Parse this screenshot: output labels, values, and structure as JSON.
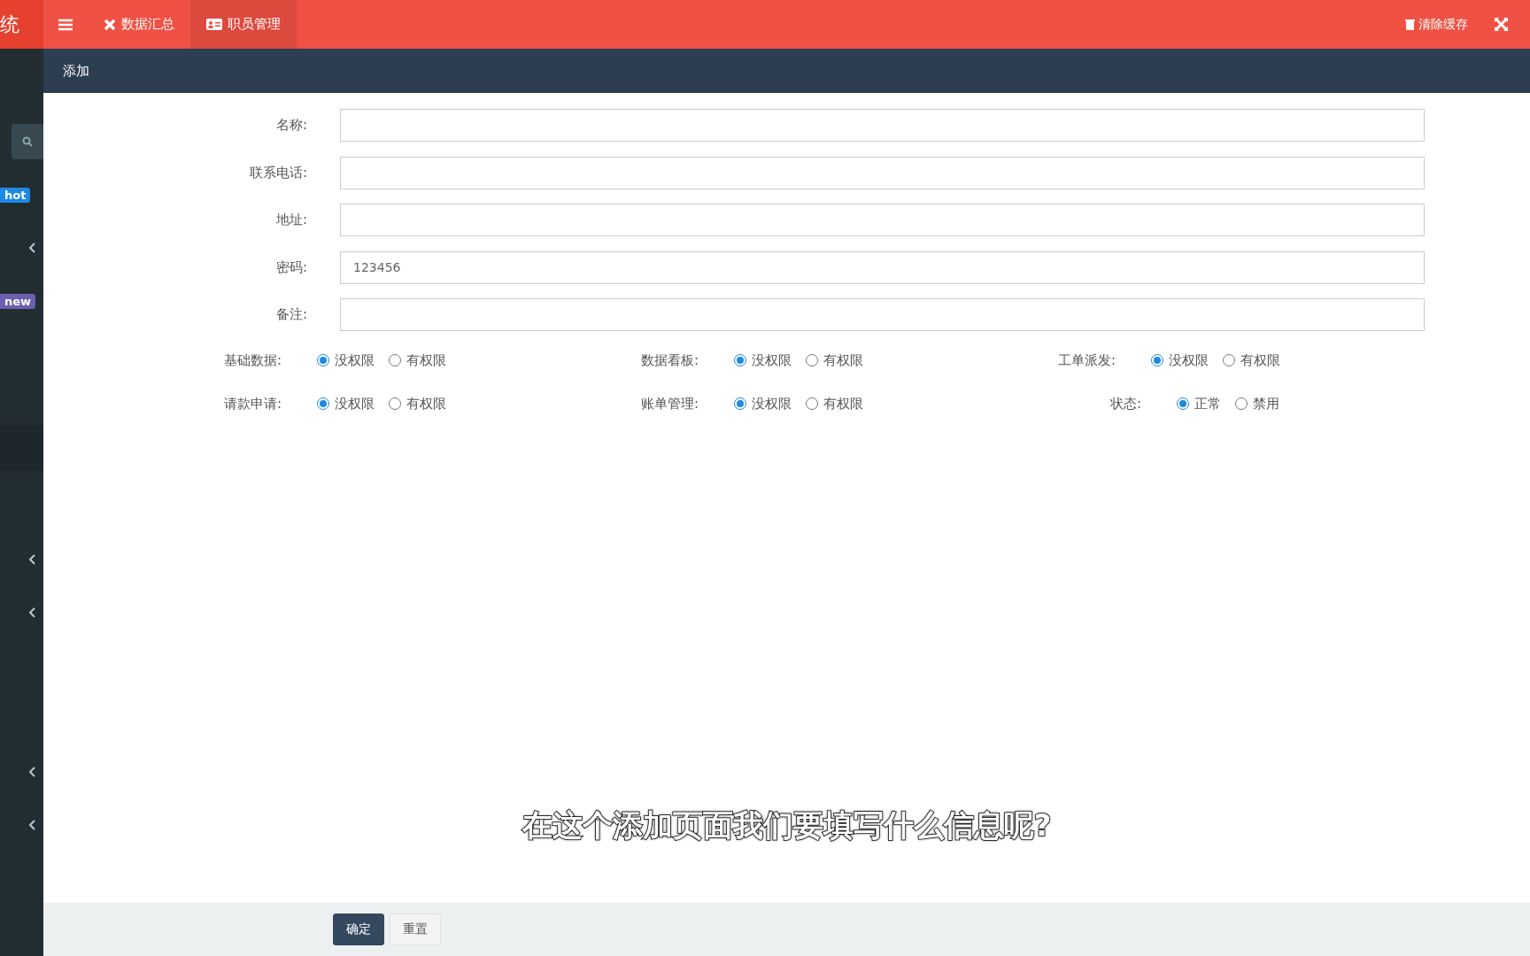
{
  "header": {
    "logo": "统",
    "tabs": [
      {
        "label": "数据汇总",
        "selected": false
      },
      {
        "label": "职员管理",
        "selected": true
      }
    ],
    "clear_cache": "清除缓存"
  },
  "sidebar": {
    "items": [
      {
        "kind": "search"
      },
      {
        "kind": "badge",
        "label": "hot",
        "color": "#1e88e5"
      },
      {
        "kind": "chevron"
      },
      {
        "kind": "badge",
        "label": "new",
        "color": "#6a5fb0"
      },
      {
        "kind": "spacer"
      },
      {
        "kind": "spacer"
      },
      {
        "kind": "active"
      },
      {
        "kind": "spacer"
      },
      {
        "kind": "chevron"
      },
      {
        "kind": "chevron"
      },
      {
        "kind": "spacer"
      },
      {
        "kind": "spacer"
      },
      {
        "kind": "chevron"
      },
      {
        "kind": "chevron"
      }
    ]
  },
  "page_title": "添加",
  "fields": [
    {
      "label": "名称:"
    },
    {
      "label": "联系电话:"
    },
    {
      "label": "地址:"
    },
    {
      "label": "密码:",
      "value": "123456"
    },
    {
      "label": "备注:"
    }
  ],
  "radio_rows": [
    [
      {
        "label": "基础数据:",
        "options": [
          {
            "label": "没权限",
            "selected": true
          },
          {
            "label": "有权限",
            "selected": false
          }
        ]
      },
      {
        "label": "数据看板:",
        "options": [
          {
            "label": "没权限",
            "selected": true
          },
          {
            "label": "有权限",
            "selected": false
          }
        ]
      },
      {
        "label": "工单派发:",
        "options": [
          {
            "label": "没权限",
            "selected": true
          },
          {
            "label": "有权限",
            "selected": false
          }
        ]
      }
    ],
    [
      {
        "label": "请款申请:",
        "options": [
          {
            "label": "没权限",
            "selected": true
          },
          {
            "label": "有权限",
            "selected": false
          }
        ]
      },
      {
        "label": "账单管理:",
        "options": [
          {
            "label": "没权限",
            "selected": true
          },
          {
            "label": "有权限",
            "selected": false
          }
        ]
      },
      {
        "label": "状态:",
        "options": [
          {
            "label": "正常",
            "selected": true
          },
          {
            "label": "禁用",
            "selected": false
          }
        ]
      }
    ]
  ],
  "caption": "在这个添加页面我们要填写什么信息呢?",
  "buttons": [
    {
      "label": "确定",
      "kind": "primary"
    },
    {
      "label": "重置",
      "kind": "default"
    }
  ]
}
